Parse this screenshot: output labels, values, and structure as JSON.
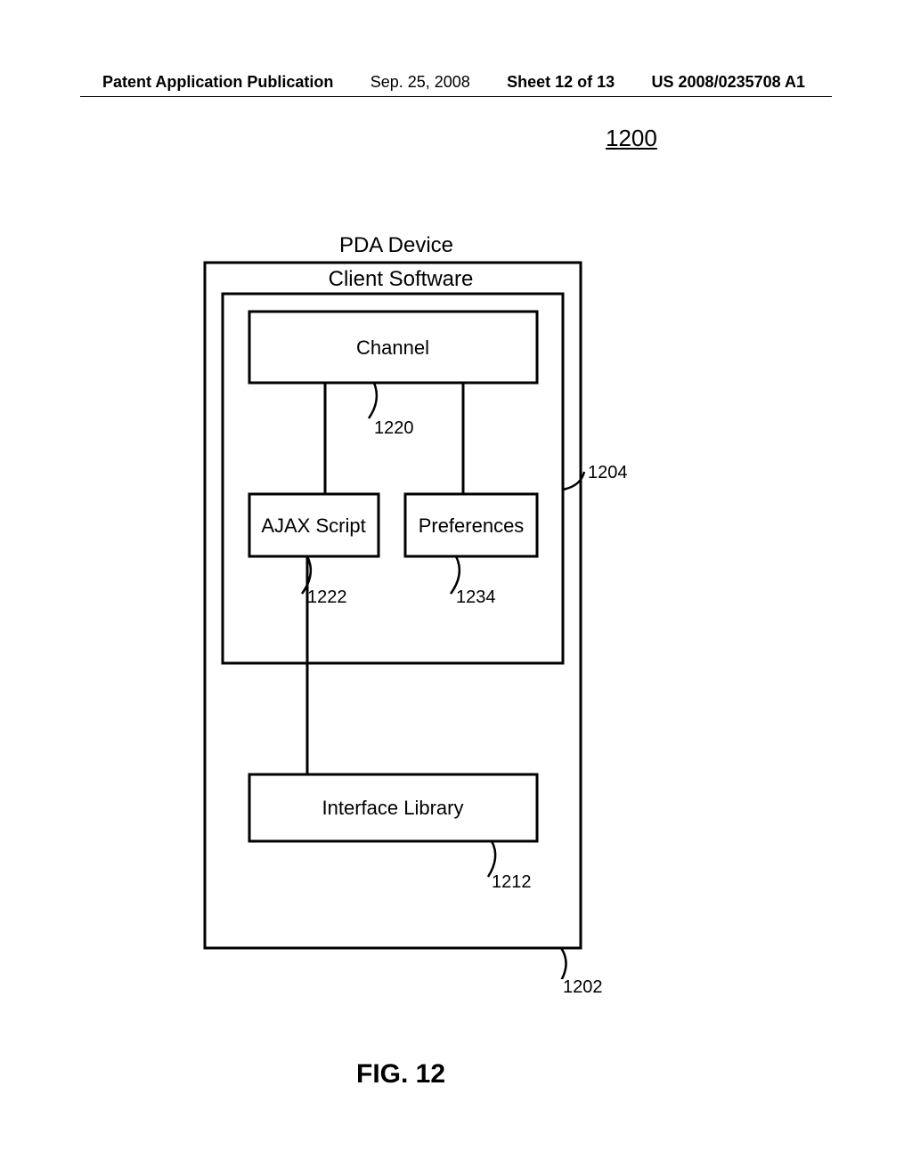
{
  "header": {
    "publication_label": "Patent Application Publication",
    "date": "Sep. 25, 2008",
    "sheet": "Sheet 12 of 13",
    "patent_number": "US 2008/0235708 A1"
  },
  "figure_reference": "1200",
  "diagram": {
    "pda_title": "PDA Device",
    "client_title": "Client Software",
    "boxes": {
      "channel": "Channel",
      "ajax": "AJAX Script",
      "prefs": "Preferences",
      "iface": "Interface Library"
    },
    "refs": {
      "channel": "1220",
      "ajax": "1222",
      "prefs": "1234",
      "client": "1204",
      "iface": "1212",
      "pda": "1202"
    }
  },
  "figure_caption": "FIG. 12"
}
